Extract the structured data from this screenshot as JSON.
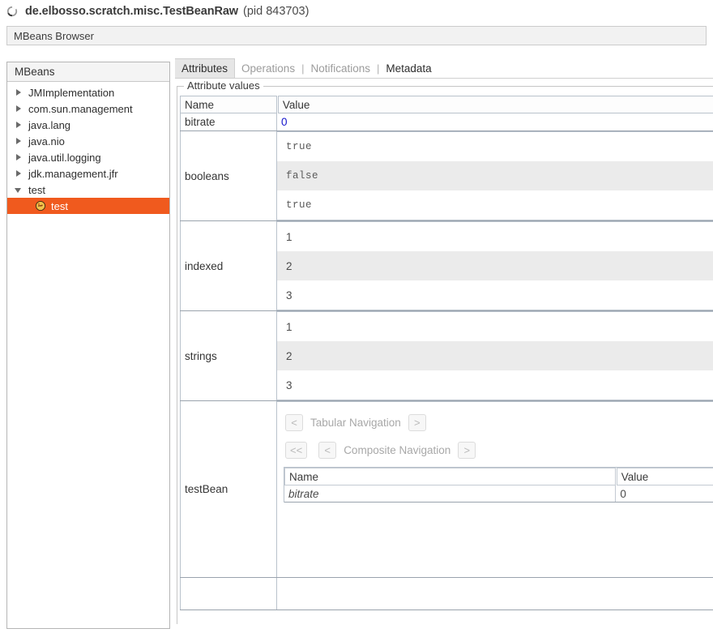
{
  "window": {
    "title": "de.elbosso.scratch.misc.TestBeanRaw",
    "pid": "(pid 843703)",
    "spinner_icon": "loading-spinner-icon"
  },
  "toolbar": {
    "browser_label": "MBeans Browser"
  },
  "tree": {
    "header": "MBeans",
    "items": [
      {
        "label": "JMImplementation",
        "level": 0,
        "state": "collapsed",
        "selected": false
      },
      {
        "label": "com.sun.management",
        "level": 0,
        "state": "collapsed",
        "selected": false
      },
      {
        "label": "java.lang",
        "level": 0,
        "state": "collapsed",
        "selected": false
      },
      {
        "label": "java.nio",
        "level": 0,
        "state": "collapsed",
        "selected": false
      },
      {
        "label": "java.util.logging",
        "level": 0,
        "state": "collapsed",
        "selected": false
      },
      {
        "label": "jdk.management.jfr",
        "level": 0,
        "state": "collapsed",
        "selected": false
      },
      {
        "label": "test",
        "level": 0,
        "state": "expanded",
        "selected": false
      },
      {
        "label": "test",
        "level": 1,
        "state": "leaf",
        "selected": true
      }
    ],
    "selection_color": "#f05a1e"
  },
  "tabs": [
    {
      "label": "Attributes",
      "active": true,
      "disabled": false
    },
    {
      "label": "Operations",
      "active": false,
      "disabled": true
    },
    {
      "label": "Notifications",
      "active": false,
      "disabled": true
    },
    {
      "label": "Metadata",
      "active": false,
      "disabled": false
    }
  ],
  "tab_separator": "|",
  "attributes": {
    "legend": "Attribute values",
    "columns": {
      "name": "Name",
      "value": "Value"
    },
    "rows": [
      {
        "type": "simple",
        "name": "bitrate",
        "value": "0"
      },
      {
        "type": "array",
        "name": "booleans",
        "mono": true,
        "values": [
          "true",
          "false",
          "true"
        ]
      },
      {
        "type": "array",
        "name": "indexed",
        "mono": false,
        "values": [
          "1",
          "2",
          "3"
        ]
      },
      {
        "type": "array",
        "name": "strings",
        "mono": false,
        "values": [
          "1",
          "2",
          "3"
        ]
      }
    ],
    "composite": {
      "name": "testBean",
      "tabular_nav": {
        "prev": "<",
        "label": "Tabular Navigation",
        "next": ">"
      },
      "composite_nav": {
        "first": "<<",
        "prev": "<",
        "label": "Composite Navigation",
        "next": ">"
      },
      "columns": {
        "name": "Name",
        "value": "Value"
      },
      "rows": [
        {
          "name": "bitrate",
          "value": "0"
        }
      ]
    }
  }
}
